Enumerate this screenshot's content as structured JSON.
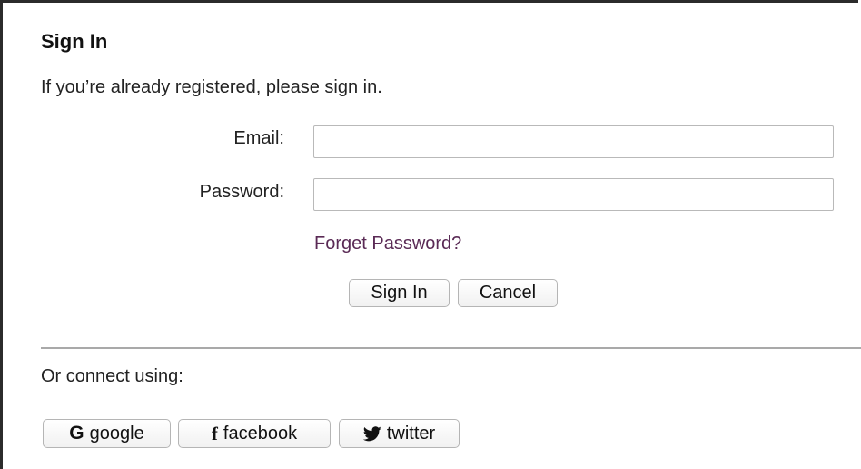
{
  "form": {
    "title": "Sign In",
    "intro": "If you’re already registered, please sign in.",
    "email_label": "Email:",
    "email_value": "",
    "password_label": "Password:",
    "password_value": "",
    "forgot_link": "Forget Password?",
    "signin_button": "Sign In",
    "cancel_button": "Cancel"
  },
  "social": {
    "heading": "Or connect using:",
    "buttons": [
      {
        "icon": "google-icon",
        "glyph": "G",
        "label": "google"
      },
      {
        "icon": "facebook-icon",
        "glyph": "f",
        "label": "facebook"
      },
      {
        "icon": "twitter-icon",
        "glyph": "",
        "label": "twitter"
      }
    ]
  }
}
